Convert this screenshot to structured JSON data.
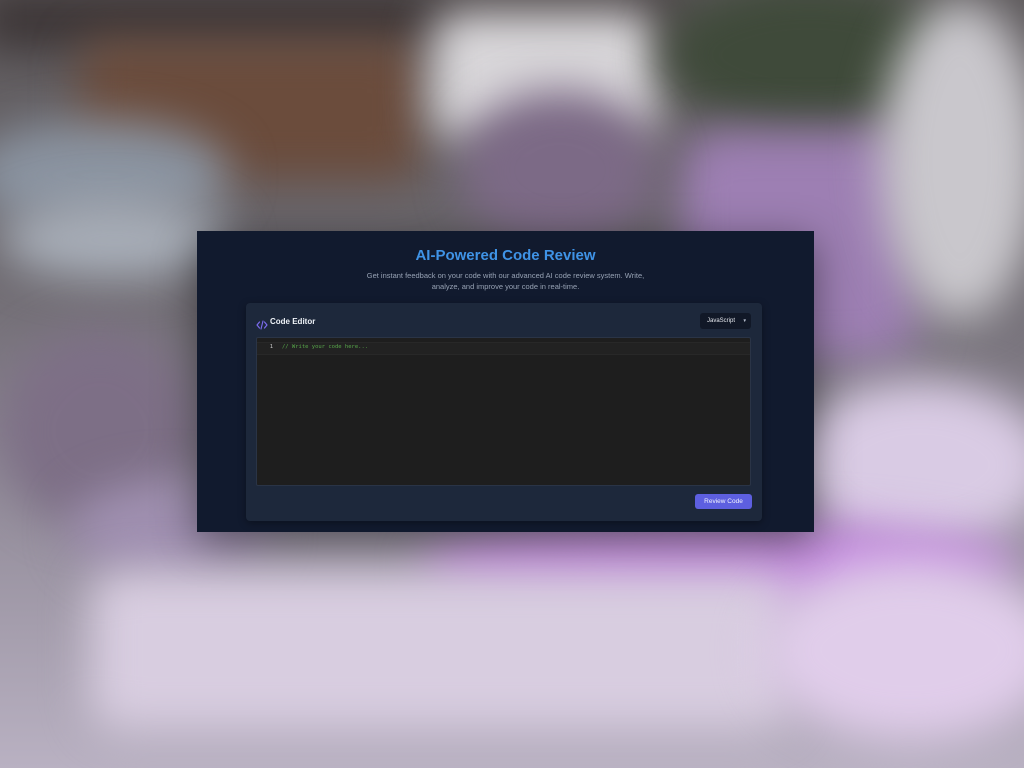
{
  "header": {
    "title": "AI-Powered Code Review",
    "subtitle": "Get instant feedback on your code with our advanced AI code review system. Write, analyze, and improve your code in real-time."
  },
  "editor": {
    "label": "Code Editor",
    "icon": "code-icon",
    "language_selected": "JavaScript",
    "line_number": "1",
    "placeholder": "// Write your code here..."
  },
  "actions": {
    "review_label": "Review Code"
  },
  "colors": {
    "title": "#3f93e6",
    "accent_button": "#5d5fe0",
    "panel": "#111a2e",
    "card": "#1d283b",
    "code_background": "#1e1e1e",
    "comment": "#57a64a"
  }
}
